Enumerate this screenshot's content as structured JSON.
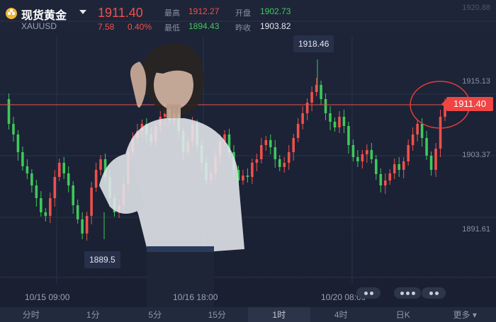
{
  "header": {
    "name": "现货黄金",
    "symbol": "XAUUSD",
    "price": "1911.40",
    "change": "7.58",
    "change_pct": "0.40%",
    "high_label": "最高",
    "high": "1912.27",
    "open_label": "开盘",
    "open": "1902.73",
    "low_label": "最低",
    "low": "1894.43",
    "prev_label": "昨收",
    "prev": "1903.82"
  },
  "axis": {
    "top_partial": "1920.88",
    "levels": [
      "1915.13",
      "1903.37",
      "1891.61"
    ]
  },
  "tooltips": {
    "max": "1918.46",
    "min": "1889.5",
    "current": "1911.40"
  },
  "time_labels": [
    "10/15 09:00",
    "10/16 18:00",
    "10/20 08:00"
  ],
  "tabs": [
    "分时",
    "1分",
    "5分",
    "15分",
    "1时",
    "4时",
    "日K",
    "更多"
  ],
  "active_tab": "1时",
  "colors": {
    "up": "#f0504b",
    "down": "#3ec95a",
    "bg": "#1b2236"
  }
}
